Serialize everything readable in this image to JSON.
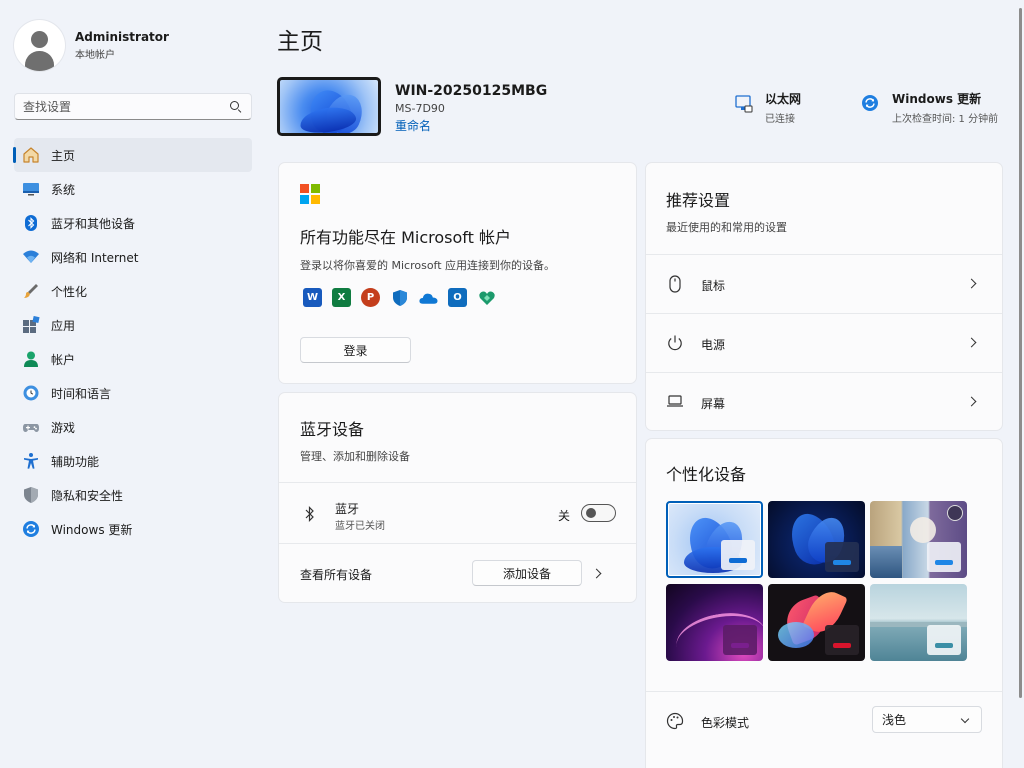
{
  "user": {
    "name": "Administrator",
    "account_type": "本地帐户"
  },
  "search": {
    "placeholder": "查找设置"
  },
  "nav": [
    {
      "label": "主页",
      "icon": "home-icon",
      "active": true
    },
    {
      "label": "系统",
      "icon": "monitor-icon"
    },
    {
      "label": "蓝牙和其他设备",
      "icon": "bluetooth-icon"
    },
    {
      "label": "网络和 Internet",
      "icon": "wifi-icon"
    },
    {
      "label": "个性化",
      "icon": "brush-icon"
    },
    {
      "label": "应用",
      "icon": "apps-icon"
    },
    {
      "label": "帐户",
      "icon": "person-icon"
    },
    {
      "label": "时间和语言",
      "icon": "clock-globe-icon"
    },
    {
      "label": "游戏",
      "icon": "gamepad-icon"
    },
    {
      "label": "辅助功能",
      "icon": "accessibility-icon"
    },
    {
      "label": "隐私和安全性",
      "icon": "shield-icon"
    },
    {
      "label": "Windows 更新",
      "icon": "update-icon"
    }
  ],
  "page": {
    "title": "主页"
  },
  "device": {
    "name": "WIN-20250125MBG",
    "model": "MS-7D90",
    "rename_label": "重命名"
  },
  "status": {
    "ethernet": {
      "title": "以太网",
      "subtitle": "已连接"
    },
    "update": {
      "title": "Windows 更新",
      "subtitle": "上次检查时间: 1 分钟前"
    }
  },
  "microsoft_card": {
    "title": "所有功能尽在 Microsoft 帐户",
    "subtitle": "登录以将你喜爱的 Microsoft 应用连接到你的设备。",
    "apps": [
      {
        "name": "word-icon",
        "letter": "W",
        "color": "#185abd"
      },
      {
        "name": "excel-icon",
        "letter": "X",
        "color": "#107c41"
      },
      {
        "name": "powerpoint-icon",
        "letter": "P",
        "color": "#c43e1c"
      },
      {
        "name": "defender-icon",
        "letter": "",
        "color": "#0f6cbd"
      },
      {
        "name": "onedrive-icon",
        "letter": "",
        "color": "#0f78d4"
      },
      {
        "name": "outlook-icon",
        "letter": "O",
        "color": "#0f6cbd"
      },
      {
        "name": "family-icon",
        "letter": "",
        "color": "#1c9a6c"
      }
    ],
    "signin_label": "登录"
  },
  "bluetooth_card": {
    "title": "蓝牙设备",
    "subtitle": "管理、添加和删除设备",
    "bt_label": "蓝牙",
    "bt_status": "蓝牙已关闭",
    "toggle_state": "关",
    "view_all_label": "查看所有设备",
    "add_device_label": "添加设备"
  },
  "recommended": {
    "title": "推荐设置",
    "subtitle": "最近使用的和常用的设置",
    "items": [
      {
        "label": "鼠标",
        "icon": "mouse-icon"
      },
      {
        "label": "电源",
        "icon": "power-icon"
      },
      {
        "label": "屏幕",
        "icon": "laptop-icon"
      }
    ]
  },
  "personalize": {
    "title": "个性化设备",
    "color_mode_label": "色彩模式",
    "color_mode_value": "浅色"
  }
}
